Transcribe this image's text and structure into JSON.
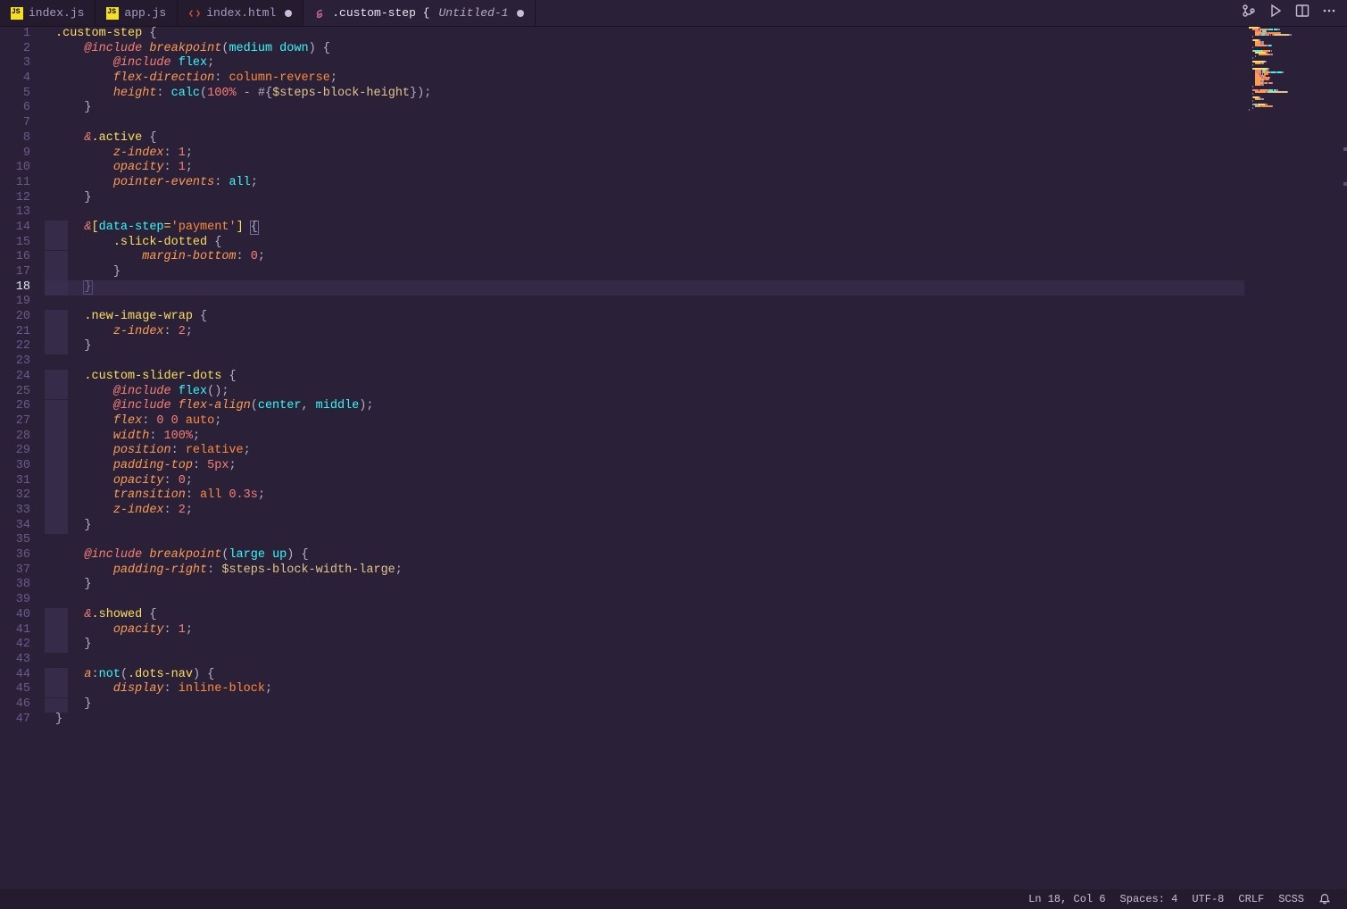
{
  "tabs": [
    {
      "icon": "js",
      "label": "index.js",
      "active": false,
      "dirty": false
    },
    {
      "icon": "js",
      "label": "app.js",
      "active": false,
      "dirty": false
    },
    {
      "icon": "html",
      "label": "index.html",
      "active": false,
      "dirty": true
    },
    {
      "icon": "scss",
      "label": ".custom-step {",
      "sub": "Untitled-1",
      "active": true,
      "dirty": true
    }
  ],
  "status": {
    "cursor": "Ln 18, Col 6",
    "spaces": "Spaces: 4",
    "encoding": "UTF-8",
    "eol": "CRLF",
    "lang": "SCSS"
  },
  "highlight_line": 18,
  "fold_mark_lines": [
    "14-18",
    "20-22",
    "24-34",
    "40-42",
    "44-46"
  ],
  "code": [
    [
      [
        "c-class",
        ".custom-step"
      ],
      [
        "c-punc",
        " {"
      ]
    ],
    [
      [
        "sp",
        "    "
      ],
      [
        "c-key",
        "@include"
      ],
      [
        "sp",
        " "
      ],
      [
        "c-func",
        "breakpoint"
      ],
      [
        "c-punc",
        "("
      ],
      [
        "c-kw",
        "medium"
      ],
      [
        "sp",
        " "
      ],
      [
        "c-kw",
        "down"
      ],
      [
        "c-punc",
        ") {"
      ]
    ],
    [
      [
        "sp",
        "        "
      ],
      [
        "c-key",
        "@include"
      ],
      [
        "sp",
        " "
      ],
      [
        "c-kw",
        "flex"
      ],
      [
        "c-punc",
        ";"
      ]
    ],
    [
      [
        "sp",
        "        "
      ],
      [
        "c-prop",
        "flex-direction"
      ],
      [
        "c-punc",
        ": "
      ],
      [
        "c-val",
        "column-reverse"
      ],
      [
        "c-punc",
        ";"
      ]
    ],
    [
      [
        "sp",
        "        "
      ],
      [
        "c-prop",
        "height"
      ],
      [
        "c-punc",
        ": "
      ],
      [
        "c-kw",
        "calc"
      ],
      [
        "c-punc",
        "("
      ],
      [
        "c-num",
        "100"
      ],
      [
        "c-unit",
        "%"
      ],
      [
        "sp",
        " "
      ],
      [
        "c-punc",
        "-"
      ],
      [
        "sp",
        " "
      ],
      [
        "c-punc",
        "#{"
      ],
      [
        "c-var",
        "$steps-block-height"
      ],
      [
        "c-punc",
        "});"
      ]
    ],
    [
      [
        "sp",
        "    "
      ],
      [
        "c-punc",
        "}"
      ]
    ],
    [],
    [
      [
        "sp",
        "    "
      ],
      [
        "c-amp",
        "&"
      ],
      [
        "c-class",
        ".active"
      ],
      [
        "c-punc",
        " {"
      ]
    ],
    [
      [
        "sp",
        "        "
      ],
      [
        "c-prop",
        "z-index"
      ],
      [
        "c-punc",
        ": "
      ],
      [
        "c-num",
        "1"
      ],
      [
        "c-punc",
        ";"
      ]
    ],
    [
      [
        "sp",
        "        "
      ],
      [
        "c-prop",
        "opacity"
      ],
      [
        "c-punc",
        ": "
      ],
      [
        "c-num",
        "1"
      ],
      [
        "c-punc",
        ";"
      ]
    ],
    [
      [
        "sp",
        "        "
      ],
      [
        "c-prop",
        "pointer-events"
      ],
      [
        "c-punc",
        ": "
      ],
      [
        "c-kw",
        "all"
      ],
      [
        "c-punc",
        ";"
      ]
    ],
    [
      [
        "sp",
        "    "
      ],
      [
        "c-punc",
        "}"
      ]
    ],
    [],
    [
      [
        "sp",
        "    "
      ],
      [
        "c-amp",
        "&"
      ],
      [
        "c-attr",
        "["
      ],
      [
        "c-kw",
        "data-step"
      ],
      [
        "c-attr",
        "="
      ],
      [
        "c-str",
        "'payment'"
      ],
      [
        "c-attr",
        "]"
      ],
      [
        "sp",
        " "
      ],
      [
        "br",
        "{"
      ]
    ],
    [
      [
        "sp",
        "        "
      ],
      [
        "c-class",
        ".slick-dotted"
      ],
      [
        "c-punc",
        " {"
      ]
    ],
    [
      [
        "sp",
        "            "
      ],
      [
        "c-prop",
        "margin-bottom"
      ],
      [
        "c-punc",
        ": "
      ],
      [
        "c-num",
        "0"
      ],
      [
        "c-punc",
        ";"
      ]
    ],
    [
      [
        "sp",
        "        "
      ],
      [
        "c-punc",
        "}"
      ]
    ],
    [
      [
        "sp",
        "    "
      ],
      [
        "br",
        "}"
      ]
    ],
    [],
    [
      [
        "sp",
        "    "
      ],
      [
        "c-class",
        ".new-image-wrap"
      ],
      [
        "c-punc",
        " {"
      ]
    ],
    [
      [
        "sp",
        "        "
      ],
      [
        "c-prop",
        "z-index"
      ],
      [
        "c-punc",
        ": "
      ],
      [
        "c-num",
        "2"
      ],
      [
        "c-punc",
        ";"
      ]
    ],
    [
      [
        "sp",
        "    "
      ],
      [
        "c-punc",
        "}"
      ]
    ],
    [],
    [
      [
        "sp",
        "    "
      ],
      [
        "c-class",
        ".custom-slider-dots"
      ],
      [
        "c-punc",
        " {"
      ]
    ],
    [
      [
        "sp",
        "        "
      ],
      [
        "c-key",
        "@include"
      ],
      [
        "sp",
        " "
      ],
      [
        "c-kw",
        "flex"
      ],
      [
        "c-punc",
        "();"
      ]
    ],
    [
      [
        "sp",
        "        "
      ],
      [
        "c-key",
        "@include"
      ],
      [
        "sp",
        " "
      ],
      [
        "c-func",
        "flex-align"
      ],
      [
        "c-punc",
        "("
      ],
      [
        "c-kw",
        "center"
      ],
      [
        "c-punc",
        ", "
      ],
      [
        "c-kw",
        "middle"
      ],
      [
        "c-punc",
        ");"
      ]
    ],
    [
      [
        "sp",
        "        "
      ],
      [
        "c-prop",
        "flex"
      ],
      [
        "c-punc",
        ": "
      ],
      [
        "c-num",
        "0"
      ],
      [
        "sp",
        " "
      ],
      [
        "c-num",
        "0"
      ],
      [
        "sp",
        " "
      ],
      [
        "c-val",
        "auto"
      ],
      [
        "c-punc",
        ";"
      ]
    ],
    [
      [
        "sp",
        "        "
      ],
      [
        "c-prop",
        "width"
      ],
      [
        "c-punc",
        ": "
      ],
      [
        "c-num",
        "100"
      ],
      [
        "c-unit",
        "%"
      ],
      [
        "c-punc",
        ";"
      ]
    ],
    [
      [
        "sp",
        "        "
      ],
      [
        "c-prop",
        "position"
      ],
      [
        "c-punc",
        ": "
      ],
      [
        "c-val",
        "relative"
      ],
      [
        "c-punc",
        ";"
      ]
    ],
    [
      [
        "sp",
        "        "
      ],
      [
        "c-prop",
        "padding-top"
      ],
      [
        "c-punc",
        ": "
      ],
      [
        "c-num",
        "5"
      ],
      [
        "c-unit",
        "px"
      ],
      [
        "c-punc",
        ";"
      ]
    ],
    [
      [
        "sp",
        "        "
      ],
      [
        "c-prop",
        "opacity"
      ],
      [
        "c-punc",
        ": "
      ],
      [
        "c-num",
        "0"
      ],
      [
        "c-punc",
        ";"
      ]
    ],
    [
      [
        "sp",
        "        "
      ],
      [
        "c-prop",
        "transition"
      ],
      [
        "c-punc",
        ": "
      ],
      [
        "c-val",
        "all"
      ],
      [
        "sp",
        " "
      ],
      [
        "c-num",
        "0.3"
      ],
      [
        "c-unit",
        "s"
      ],
      [
        "c-punc",
        ";"
      ]
    ],
    [
      [
        "sp",
        "        "
      ],
      [
        "c-prop",
        "z-index"
      ],
      [
        "c-punc",
        ": "
      ],
      [
        "c-num",
        "2"
      ],
      [
        "c-punc",
        ";"
      ]
    ],
    [
      [
        "sp",
        "    "
      ],
      [
        "c-punc",
        "}"
      ]
    ],
    [],
    [
      [
        "sp",
        "    "
      ],
      [
        "c-key",
        "@include"
      ],
      [
        "sp",
        " "
      ],
      [
        "c-func",
        "breakpoint"
      ],
      [
        "c-punc",
        "("
      ],
      [
        "c-kw",
        "large"
      ],
      [
        "sp",
        " "
      ],
      [
        "c-kw",
        "up"
      ],
      [
        "c-punc",
        ") {"
      ]
    ],
    [
      [
        "sp",
        "        "
      ],
      [
        "c-prop",
        "padding-right"
      ],
      [
        "c-punc",
        ": "
      ],
      [
        "c-var",
        "$steps-block-width-large"
      ],
      [
        "c-punc",
        ";"
      ]
    ],
    [
      [
        "sp",
        "    "
      ],
      [
        "c-punc",
        "}"
      ]
    ],
    [],
    [
      [
        "sp",
        "    "
      ],
      [
        "c-amp",
        "&"
      ],
      [
        "c-class",
        ".showed"
      ],
      [
        "c-punc",
        " {"
      ]
    ],
    [
      [
        "sp",
        "        "
      ],
      [
        "c-prop",
        "opacity"
      ],
      [
        "c-punc",
        ": "
      ],
      [
        "c-num",
        "1"
      ],
      [
        "c-punc",
        ";"
      ]
    ],
    [
      [
        "sp",
        "    "
      ],
      [
        "c-punc",
        "}"
      ]
    ],
    [],
    [
      [
        "sp",
        "    "
      ],
      [
        "c-func",
        "a"
      ],
      [
        "c-punc",
        ":"
      ],
      [
        "c-kw",
        "not"
      ],
      [
        "c-punc",
        "("
      ],
      [
        "c-class",
        ".dots-nav"
      ],
      [
        "c-punc",
        ") {"
      ]
    ],
    [
      [
        "sp",
        "        "
      ],
      [
        "c-prop",
        "display"
      ],
      [
        "c-punc",
        ": "
      ],
      [
        "c-val",
        "inline-block"
      ],
      [
        "c-punc",
        ";"
      ]
    ],
    [
      [
        "sp",
        "    "
      ],
      [
        "c-punc",
        "}"
      ]
    ],
    [
      [
        "c-punc",
        "}"
      ]
    ]
  ]
}
